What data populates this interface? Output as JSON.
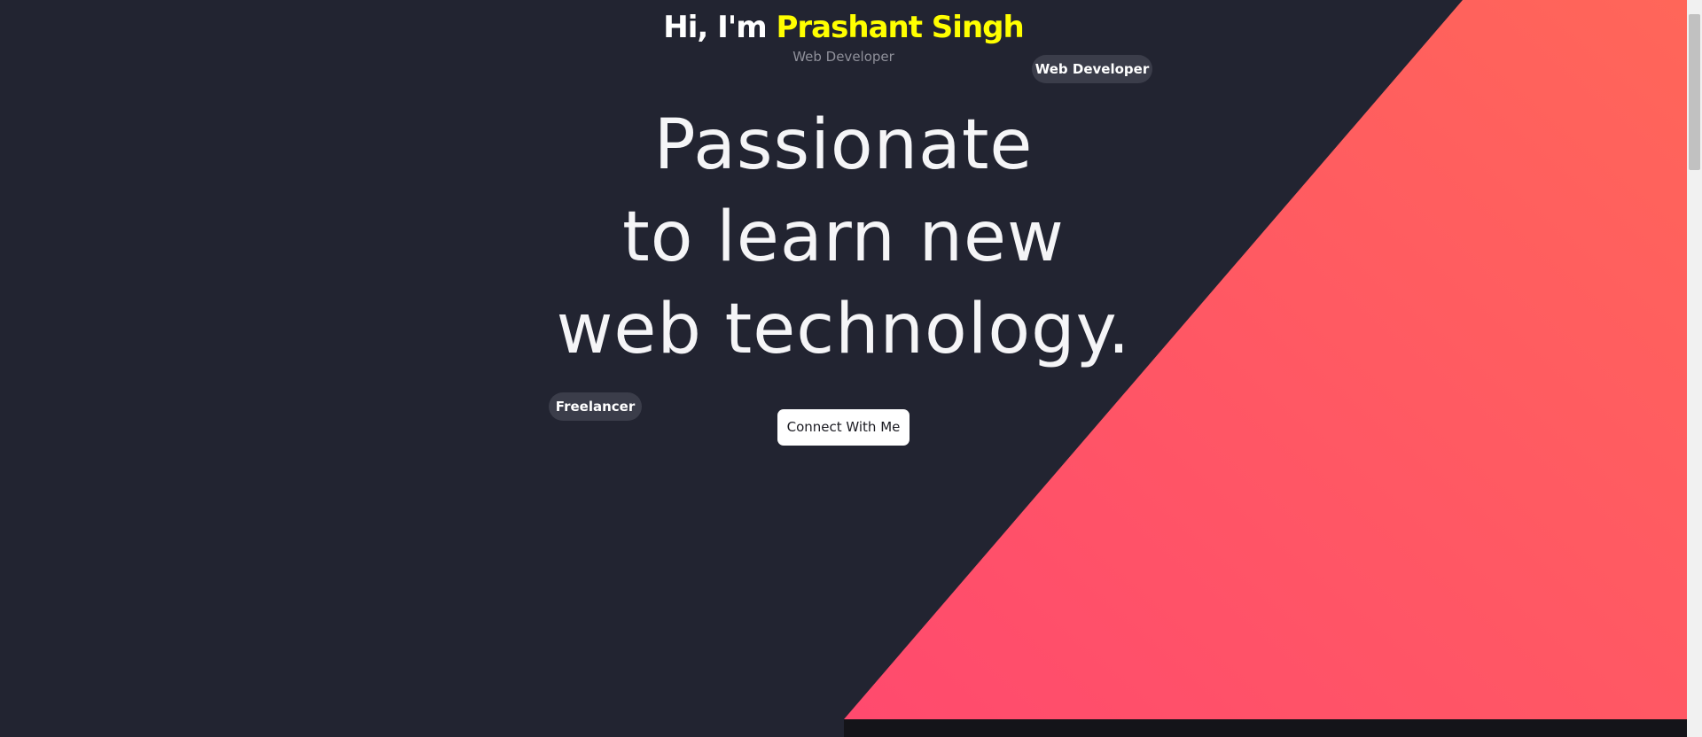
{
  "greeting": {
    "prefix": "Hi, I'm",
    "name": "Prashant Singh"
  },
  "role_subtitle": "Web Developer",
  "badges": {
    "web_developer": "Web Developer",
    "freelancer": "Freelancer"
  },
  "headline": {
    "line1": "Passionate",
    "line2": "to learn new",
    "line3": "web technology."
  },
  "cta": {
    "label": "Connect With Me"
  },
  "colors": {
    "background": "#222431",
    "accent_name": "#ffff00",
    "gradient_start": "#ff4a6e",
    "gradient_end": "#ff6659",
    "badge_bg": "#3b3d4a",
    "button_bg": "#ffffff"
  }
}
